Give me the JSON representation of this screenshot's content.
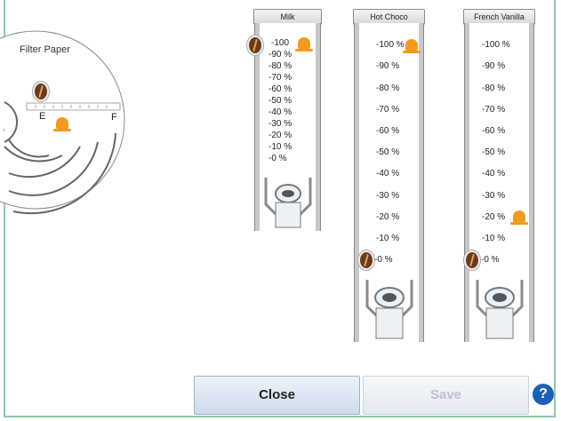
{
  "filter": {
    "title": "Filter Paper",
    "start_label": "E",
    "end_label": "F"
  },
  "tubes": [
    {
      "name": "Milk",
      "labels": [
        "-100 %",
        "-90 %",
        "-80 %",
        "-70 %",
        "-60 %",
        "-50 %",
        "-40 %",
        "-30 %",
        "-20 %",
        "-10 %",
        "-0 %"
      ],
      "bean_label": "-100",
      "bean_level_percent": 100,
      "alert_level_percent": 100
    },
    {
      "name": "Hot Choco",
      "labels": [
        "-100 %",
        "-90 %",
        "-80 %",
        "-70 %",
        "-60 %",
        "-50 %",
        "-40 %",
        "-30 %",
        "-20 %",
        "-10 %",
        "-0 %"
      ],
      "bean_level_percent": 0,
      "alert_level_percent": 100
    },
    {
      "name": "French Vanilla",
      "labels": [
        "-100 %",
        "-90 %",
        "-80 %",
        "-70 %",
        "-60 %",
        "-50 %",
        "-40 %",
        "-30 %",
        "-20 %",
        "-10 %",
        "-0 %"
      ],
      "bean_level_percent": 0,
      "alert_level_percent": 20
    }
  ],
  "buttons": {
    "close": "Close",
    "save": "Save",
    "help": "?"
  },
  "icons": {
    "bean": "coffee-bean-icon",
    "alert": "bell-icon",
    "help": "question-icon"
  },
  "colors": {
    "bean": "#6b3b1a",
    "bell": "#f39a1e",
    "help": "#1c5fb8",
    "frame": "#8fc8a8"
  }
}
